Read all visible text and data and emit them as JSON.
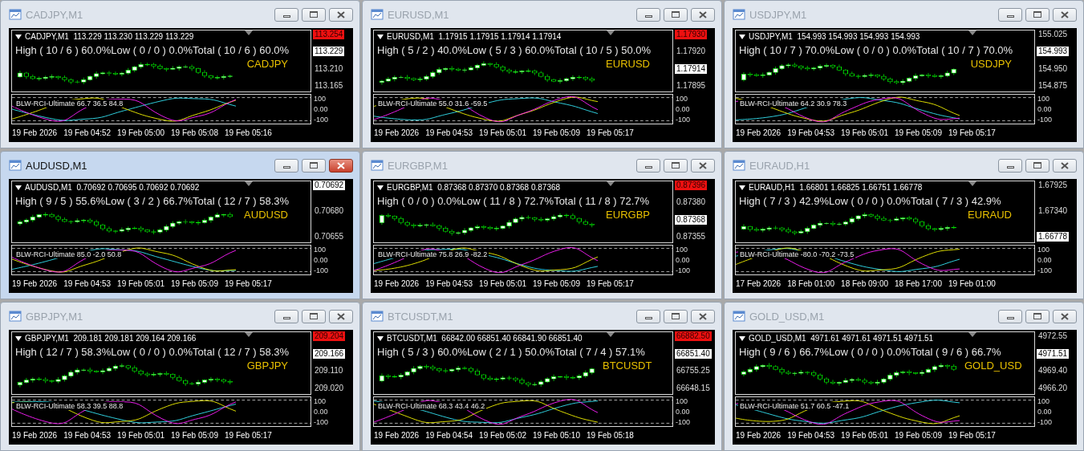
{
  "windows": [
    {
      "title": "CADJPY,M1",
      "active": false,
      "info": "CADJPY,M1  113.229 113.230 113.229 113.229",
      "stats": "High ( 10 / 6 ) 60.0%Low ( 0 / 0 ) 0.0%Total ( 10 / 6 ) 60.0%",
      "symbol": "CADJPY",
      "price_axis": [
        {
          "text": "113.254",
          "kind": "alert"
        },
        {
          "text": "113.229",
          "kind": "bid"
        },
        {
          "text": "113.210",
          "kind": "tick"
        },
        {
          "text": "113.165",
          "kind": "tick"
        }
      ],
      "indicator": {
        "label": "BLW-RCI-Ultimate 66.7 36.5 84.8",
        "axis": [
          "100",
          "0.00",
          "-100"
        ]
      },
      "times": [
        "19 Feb 2026",
        "19 Feb 04:52",
        "19 Feb 05:00",
        "19 Feb 05:08",
        "19 Feb 05:16"
      ]
    },
    {
      "title": "EURUSD,M1",
      "active": false,
      "info": "EURUSD,M1  1.17915 1.17915 1.17914 1.17914",
      "stats": "High ( 5 / 2 ) 40.0%Low ( 5 / 3 ) 60.0%Total ( 10 / 5 ) 50.0%",
      "symbol": "EURUSD",
      "price_axis": [
        {
          "text": "1.17930",
          "kind": "alert"
        },
        {
          "text": "1.17920",
          "kind": "tick"
        },
        {
          "text": "1.17914",
          "kind": "bid"
        },
        {
          "text": "1.17895",
          "kind": "tick"
        }
      ],
      "indicator": {
        "label": "BLW-RCI-Ultimate 55.0 31.6 -59.5",
        "axis": [
          "100",
          "0.00",
          "-100"
        ]
      },
      "times": [
        "19 Feb 2026",
        "19 Feb 04:53",
        "19 Feb 05:01",
        "19 Feb 05:09",
        "19 Feb 05:17"
      ]
    },
    {
      "title": "USDJPY,M1",
      "active": false,
      "info": "USDJPY,M1  154.993 154.993 154.993 154.993",
      "stats": "High ( 10 / 7 ) 70.0%Low ( 0 / 0 ) 0.0%Total ( 10 / 7 ) 70.0%",
      "symbol": "USDJPY",
      "price_axis": [
        {
          "text": "155.025",
          "kind": "tick"
        },
        {
          "text": "154.993",
          "kind": "bid"
        },
        {
          "text": "154.950",
          "kind": "tick"
        },
        {
          "text": "154.875",
          "kind": "tick"
        }
      ],
      "indicator": {
        "label": "BLW-RCI-Ultimate 64.2 30.9 78.3",
        "axis": [
          "100",
          "0.00",
          "-100"
        ]
      },
      "times": [
        "19 Feb 2026",
        "19 Feb 04:53",
        "19 Feb 05:01",
        "19 Feb 05:09",
        "19 Feb 05:17"
      ]
    },
    {
      "title": "AUDUSD,M1",
      "active": true,
      "info": "AUDUSD,M1  0.70692 0.70695 0.70692 0.70692",
      "stats": "High ( 9 / 5 ) 55.6%Low ( 3 / 2 ) 66.7%Total ( 12 / 7 ) 58.3%",
      "symbol": "AUDUSD",
      "price_axis": [
        {
          "text": "0.70692",
          "kind": "bid"
        },
        {
          "text": "0.70680",
          "kind": "tick"
        },
        {
          "text": "0.70655",
          "kind": "tick"
        }
      ],
      "indicator": {
        "label": "BLW-RCI-Ultimate 85.0 -2.0 50.8",
        "axis": [
          "100",
          "0.00",
          "-100"
        ]
      },
      "times": [
        "19 Feb 2026",
        "19 Feb 04:53",
        "19 Feb 05:01",
        "19 Feb 05:09",
        "19 Feb 05:17"
      ]
    },
    {
      "title": "EURGBP,M1",
      "active": false,
      "info": "EURGBP,M1  0.87368 0.87370 0.87368 0.87368",
      "stats": "High ( 0 / 0 ) 0.0%Low ( 11 / 8 ) 72.7%Total ( 11 / 8 ) 72.7%",
      "symbol": "EURGBP",
      "price_axis": [
        {
          "text": "0.87396",
          "kind": "alert"
        },
        {
          "text": "0.87380",
          "kind": "tick"
        },
        {
          "text": "0.87368",
          "kind": "bid"
        },
        {
          "text": "0.87355",
          "kind": "tick"
        }
      ],
      "indicator": {
        "label": "BLW-RCI-Ultimate 75.8 26.9 -82.2",
        "axis": [
          "100",
          "0.00",
          "-100"
        ]
      },
      "times": [
        "19 Feb 2026",
        "19 Feb 04:53",
        "19 Feb 05:01",
        "19 Feb 05:09",
        "19 Feb 05:17"
      ]
    },
    {
      "title": "EURAUD,H1",
      "active": false,
      "info": "EURAUD,H1  1.66801 1.66825 1.66751 1.66778",
      "stats": "High ( 7 / 3 ) 42.9%Low ( 0 / 0 ) 0.0%Total ( 7 / 3 ) 42.9%",
      "symbol": "EURAUD",
      "price_axis": [
        {
          "text": "1.67925",
          "kind": "tick"
        },
        {
          "text": "1.67340",
          "kind": "tick"
        },
        {
          "text": "1.66778",
          "kind": "bid"
        }
      ],
      "indicator": {
        "label": "BLW-RCI-Ultimate -80.0 -70.2 -73.5",
        "axis": [
          "100",
          "0.00",
          "-100"
        ]
      },
      "times": [
        "17 Feb 2026",
        "18 Feb 01:00",
        "18 Feb 09:00",
        "18 Feb 17:00",
        "19 Feb 01:00"
      ]
    },
    {
      "title": "GBPJPY,M1",
      "active": false,
      "info": "GBPJPY,M1  209.181 209.181 209.164 209.166",
      "stats": "High ( 12 / 7 ) 58.3%Low ( 0 / 0 ) 0.0%Total ( 12 / 7 ) 58.3%",
      "symbol": "GBPJPY",
      "price_axis": [
        {
          "text": "209.204",
          "kind": "alert"
        },
        {
          "text": "209.166",
          "kind": "bid"
        },
        {
          "text": "209.110",
          "kind": "tick"
        },
        {
          "text": "209.020",
          "kind": "tick"
        }
      ],
      "indicator": {
        "label": "BLW-RCI-Ultimate 58.3 39.5 88.8",
        "axis": [
          "100",
          "0.00",
          "-100"
        ]
      },
      "times": [
        "19 Feb 2026",
        "19 Feb 04:53",
        "19 Feb 05:01",
        "19 Feb 05:09",
        "19 Feb 05:17"
      ]
    },
    {
      "title": "BTCUSDT,M1",
      "active": false,
      "info": "BTCUSDT,M1  66842.00 66851.40 66841.90 66851.40",
      "stats": "High ( 5 / 3 ) 60.0%Low ( 2 / 1 ) 50.0%Total ( 7 / 4 ) 57.1%",
      "symbol": "BTCUSDT",
      "price_axis": [
        {
          "text": "66882.50",
          "kind": "alert"
        },
        {
          "text": "66851.40",
          "kind": "bid"
        },
        {
          "text": "66755.25",
          "kind": "tick"
        },
        {
          "text": "66648.15",
          "kind": "tick"
        }
      ],
      "indicator": {
        "label": "BLW-RCI-Ultimate 68.3 43.4 46.2",
        "axis": [
          "100",
          "0.00",
          "-100"
        ]
      },
      "times": [
        "19 Feb 2026",
        "19 Feb 04:54",
        "19 Feb 05:02",
        "19 Feb 05:10",
        "19 Feb 05:18"
      ]
    },
    {
      "title": "GOLD_USD,M1",
      "active": false,
      "info": "GOLD_USD,M1  4971.61 4971.61 4971.51 4971.51",
      "stats": "High ( 9 / 6 ) 66.7%Low ( 0 / 0 ) 0.0%Total ( 9 / 6 ) 66.7%",
      "symbol": "GOLD_USD",
      "price_axis": [
        {
          "text": "4972.55",
          "kind": "tick"
        },
        {
          "text": "4971.51",
          "kind": "bid"
        },
        {
          "text": "4969.40",
          "kind": "tick"
        },
        {
          "text": "4966.20",
          "kind": "tick"
        }
      ],
      "indicator": {
        "label": "BLW-RCI-Ultimate 51.7 60.5 -47.1",
        "axis": [
          "100",
          "0.00",
          "-100"
        ]
      },
      "times": [
        "19 Feb 2026",
        "19 Feb 04:53",
        "19 Feb 05:01",
        "19 Feb 05:09",
        "19 Feb 05:17"
      ]
    }
  ]
}
